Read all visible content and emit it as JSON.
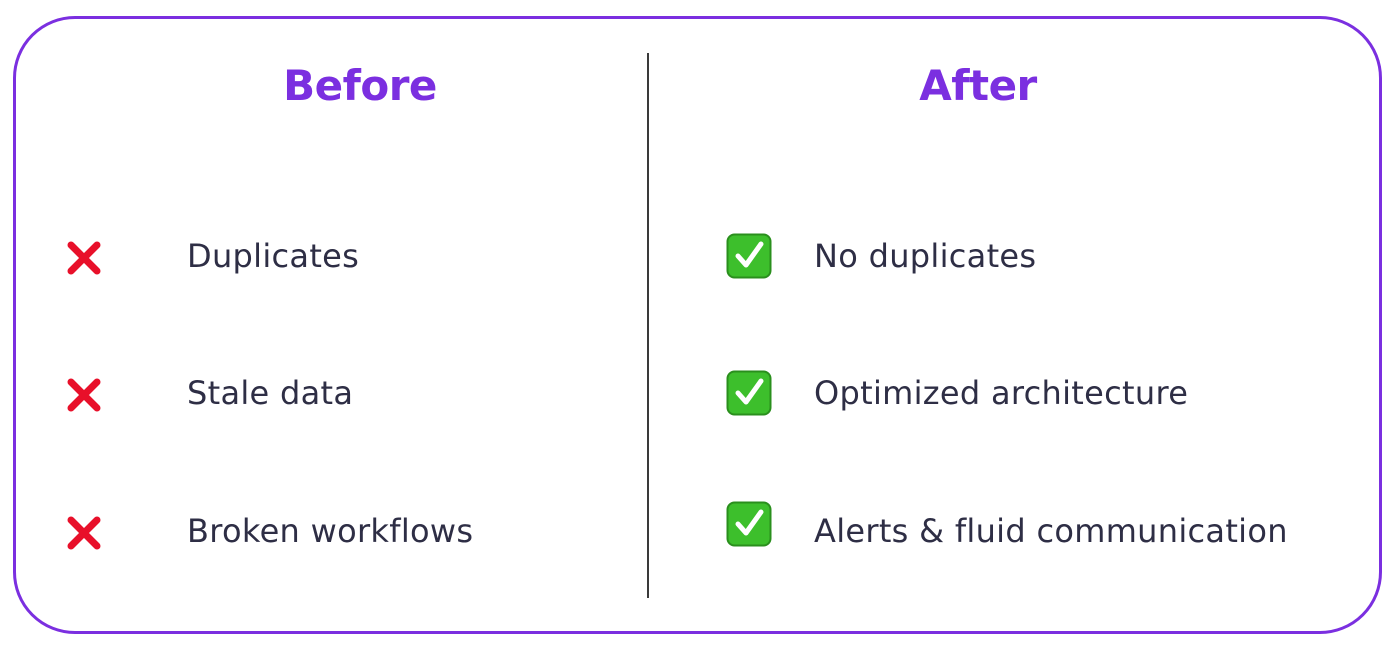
{
  "before": {
    "title": "Before",
    "items": [
      {
        "label": "Duplicates",
        "icon": "cross-mark-icon"
      },
      {
        "label": "Stale data",
        "icon": "cross-mark-icon"
      },
      {
        "label": "Broken workflows",
        "icon": "cross-mark-icon"
      }
    ]
  },
  "after": {
    "title": "After",
    "items": [
      {
        "label": "No duplicates",
        "icon": "check-mark-box-icon"
      },
      {
        "label": "Optimized architecture",
        "icon": "check-mark-box-icon"
      },
      {
        "label": "Alerts & fluid communication",
        "icon": "check-mark-box-icon"
      }
    ]
  },
  "colors": {
    "accent": "#7b2fe0",
    "cross": "#e8102a",
    "check_bg": "#3dbf2c",
    "text": "#2e2e45"
  }
}
